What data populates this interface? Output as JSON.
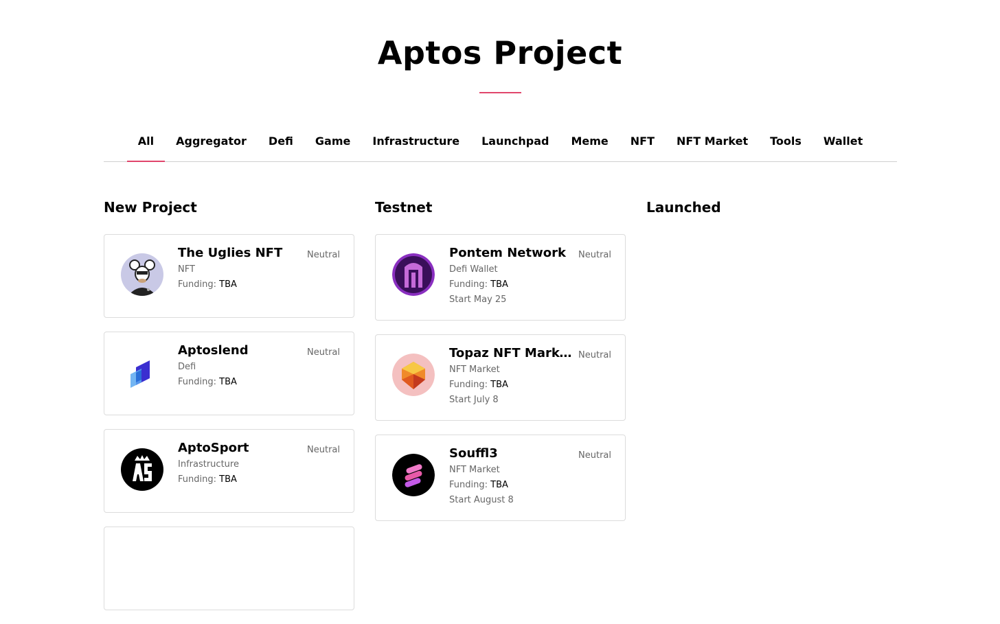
{
  "page": {
    "title": "Aptos Project",
    "accent": "#e0456b"
  },
  "tabs": [
    "All",
    "Aggregator",
    "Defi",
    "Game",
    "Infrastructure",
    "Launchpad",
    "Meme",
    "NFT",
    "NFT Market",
    "Tools",
    "Wallet"
  ],
  "columns": {
    "new": {
      "title": "New Project",
      "cards": [
        {
          "name": "The Uglies NFT",
          "category": "NFT",
          "funding_label": "Funding:",
          "funding": "TBA",
          "status": "Neutral",
          "logo": "uglies-rat-logo"
        },
        {
          "name": "Aptoslend",
          "category": "Defi",
          "funding_label": "Funding:",
          "funding": "TBA",
          "status": "Neutral",
          "logo": "aptoslend-logo"
        },
        {
          "name": "AptoSport",
          "category": "Infrastructure",
          "funding_label": "Funding:",
          "funding": "TBA",
          "status": "Neutral",
          "logo": "aptosport-logo"
        }
      ]
    },
    "testnet": {
      "title": "Testnet",
      "cards": [
        {
          "name": "Pontem Network",
          "category": "Defi Wallet",
          "funding_label": "Funding:",
          "funding": "TBA",
          "start": "Start May 25",
          "status": "Neutral",
          "logo": "pontem-logo"
        },
        {
          "name": "Topaz NFT Market…",
          "category": "NFT Market",
          "funding_label": "Funding:",
          "funding": "TBA",
          "start": "Start July 8",
          "status": "Neutral",
          "logo": "topaz-logo"
        },
        {
          "name": "Souffl3",
          "category": "NFT Market",
          "funding_label": "Funding:",
          "funding": "TBA",
          "start": "Start August 8",
          "status": "Neutral",
          "logo": "souffl3-logo"
        }
      ]
    },
    "launched": {
      "title": "Launched"
    }
  }
}
